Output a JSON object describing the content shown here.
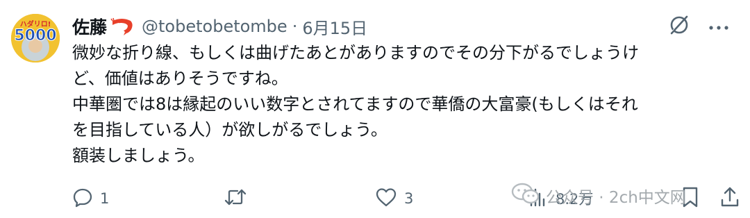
{
  "tweet": {
    "author_name": "佐藤",
    "handle": "@tobetobetombe",
    "separator": "·",
    "date": "6月15日",
    "avatar_badge_text": "5000",
    "avatar_top_text": "ハダリロ!",
    "lines": [
      "微妙な折り線、もしくは曲げたあとがありますのでその分下がるでしょうけ",
      "ど、価値はありそうですね。",
      "中華圏では8は縁起のいい数字とされてますので華僑の大富豪(もしくはそれ",
      "を目指している人）が欲しがるでしょう。",
      "額装しましょう。"
    ]
  },
  "actions": {
    "reply_count": "1",
    "retweet_count": "",
    "like_count": "3",
    "view_count": "8.2万"
  },
  "watermark": {
    "text": "公众号 · 2ch中文网"
  },
  "colors": {
    "text": "#0f1419",
    "secondary": "#536471",
    "watermark": "#a3a9ad",
    "avatar_yellow": "#f2c230"
  }
}
